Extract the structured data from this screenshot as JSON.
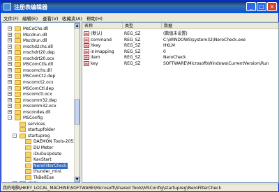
{
  "window": {
    "title": "注册表编辑器"
  },
  "menu": [
    "文件(F)",
    "编辑(E)",
    "查看(V)",
    "收藏夹(A)",
    "帮助(H)"
  ],
  "tree": [
    {
      "label": "MsCoChs.dll",
      "expander": "+",
      "level": 0
    },
    {
      "label": "Mscdrun.dll",
      "expander": "+",
      "level": 0
    },
    {
      "label": "Mscdrun.dll",
      "expander": "+",
      "level": 0
    },
    {
      "label": "mschd2chs.dll",
      "expander": "+",
      "level": 0
    },
    {
      "label": "mschdrt20.dep",
      "expander": "+",
      "level": 0
    },
    {
      "label": "mschdrt20.ocx",
      "expander": "+",
      "level": 0
    },
    {
      "label": "MSComCtls.dll",
      "expander": "+",
      "level": 0
    },
    {
      "label": "mscomchs.dll",
      "expander": "+",
      "level": 0
    },
    {
      "label": "MSComCt2.dep",
      "expander": "+",
      "level": 0
    },
    {
      "label": "mscomct2.ocx",
      "expander": "+",
      "level": 0
    },
    {
      "label": "MSComCtl.dep",
      "expander": "+",
      "level": 0
    },
    {
      "label": "mscomctl.ocx",
      "expander": "+",
      "level": 0
    },
    {
      "label": "mscomm32.dep",
      "expander": "+",
      "level": 0
    },
    {
      "label": "mscomm32.ocx",
      "expander": "+",
      "level": 0
    },
    {
      "label": "mscondes.dll",
      "expander": "+",
      "level": 0
    },
    {
      "label": "MSConfig",
      "expander": "-",
      "level": 0
    },
    {
      "label": "services",
      "expander": "",
      "level": 1
    },
    {
      "label": "startupfolder",
      "expander": "",
      "level": 1
    },
    {
      "label": "startupreg",
      "expander": "-",
      "level": 1
    },
    {
      "label": "DAEMON Tools-2052",
      "expander": "",
      "level": 2
    },
    {
      "label": "DU Meter",
      "expander": "",
      "level": 2
    },
    {
      "label": "iDuDuUpdate",
      "expander": "",
      "level": 2
    },
    {
      "label": "KavStart",
      "expander": "",
      "level": 2
    },
    {
      "label": "NeroFilterCheck",
      "expander": "",
      "level": 2,
      "selected": true
    },
    {
      "label": "thunder_mini",
      "expander": "",
      "level": 2
    },
    {
      "label": "TkBellExe",
      "expander": "",
      "level": 2
    },
    {
      "label": "state",
      "expander": "+",
      "level": 1
    }
  ],
  "columns": {
    "name": "名称",
    "type": "类型",
    "data": "数据"
  },
  "values": [
    {
      "name": "(默认)",
      "type": "REG_SZ",
      "data": "(数值未设置)"
    },
    {
      "name": "command",
      "type": "REG_SZ",
      "data": "C:\\WINDOWS\\system32\\NeroCheck.exe"
    },
    {
      "name": "hkey",
      "type": "REG_SZ",
      "data": "HKLM"
    },
    {
      "name": "inimapping",
      "type": "REG_SZ",
      "data": "0"
    },
    {
      "name": "item",
      "type": "REG_SZ",
      "data": "NeroCheck"
    },
    {
      "name": "key",
      "type": "REG_SZ",
      "data": "SOFTWARE\\Microsoft\\Windows\\CurrentVersion\\Run"
    }
  ],
  "status": "我的电脑\\HKEY_LOCAL_MACHINE\\SOFTWARE\\Microsoft\\Shared Tools\\MSConfig\\startupreg\\NeroFilterCheck",
  "icons": {
    "value_type": "ab"
  }
}
